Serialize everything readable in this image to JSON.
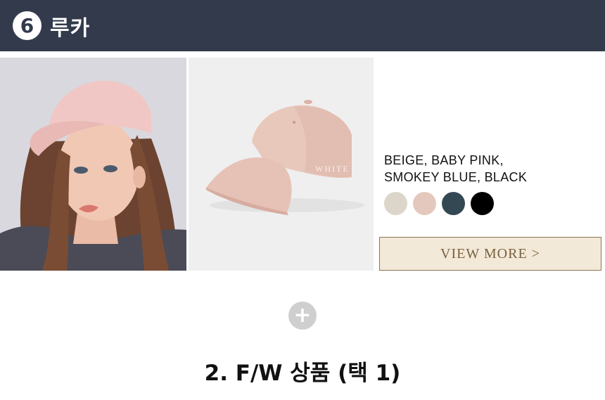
{
  "header": {
    "number": "6",
    "title": "루카",
    "background": "#323a4c"
  },
  "product": {
    "colors_line1": "BEIGE, BABY PINK,",
    "colors_line2": "SMOKEY BLUE, BLACK",
    "swatches": [
      {
        "name": "beige",
        "hex": "#dcd5ca"
      },
      {
        "name": "baby-pink",
        "hex": "#e5c8bd"
      },
      {
        "name": "smokey-blue",
        "hex": "#334852"
      },
      {
        "name": "black",
        "hex": "#000000"
      }
    ],
    "cap_print": "WHITE",
    "view_more_label": "VIEW MORE >"
  },
  "divider": {
    "icon": "plus-icon",
    "symbol": "+"
  },
  "next_section": {
    "title": "2. F/W 상품 (택 1)"
  }
}
